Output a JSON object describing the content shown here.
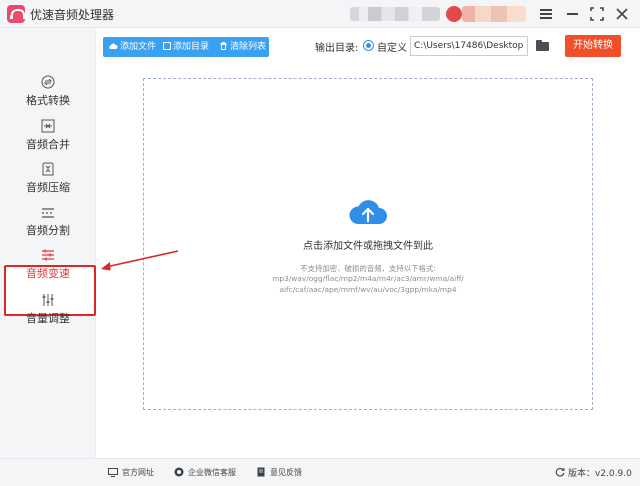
{
  "window": {
    "title": "优速音频处理器"
  },
  "sidebar": {
    "items": [
      {
        "label": "格式转换",
        "icon": "format-convert-icon"
      },
      {
        "label": "音频合并",
        "icon": "merge-icon"
      },
      {
        "label": "音频压缩",
        "icon": "compress-icon"
      },
      {
        "label": "音频分割",
        "icon": "split-icon"
      },
      {
        "label": "音频变速",
        "icon": "speed-icon",
        "active": true
      },
      {
        "label": "音量调整",
        "icon": "volume-sliders-icon"
      }
    ]
  },
  "toolbar": {
    "add_file": "添加文件",
    "add_folder": "添加目录",
    "clear_list": "清除列表",
    "output_label": "输出目录:",
    "output_option": "自定义",
    "output_path": "C:\\Users\\17486\\Desktop",
    "start_button": "开始转换"
  },
  "dropzone": {
    "title": "点击添加文件或拖拽文件到此",
    "hint_line1": "不支持加密、破损的音频，支持以下格式:",
    "hint_line2": "mp3/wav/ogg/flac/mp2/m4a/m4r/ac3/amr/wma/aiff/",
    "hint_line3": "aifc/caf/aac/ape/mmf/wv/au/voc/3gpp/mka/mp4"
  },
  "footer": {
    "website": "官方网址",
    "wechat_support": "企业微信客服",
    "feedback": "意见反馈",
    "version": "版本：v2.0.9.0"
  },
  "colors": {
    "accent_blue": "#3aa1f0",
    "start_orange": "#f04f2a",
    "active_red": "#e02525"
  }
}
